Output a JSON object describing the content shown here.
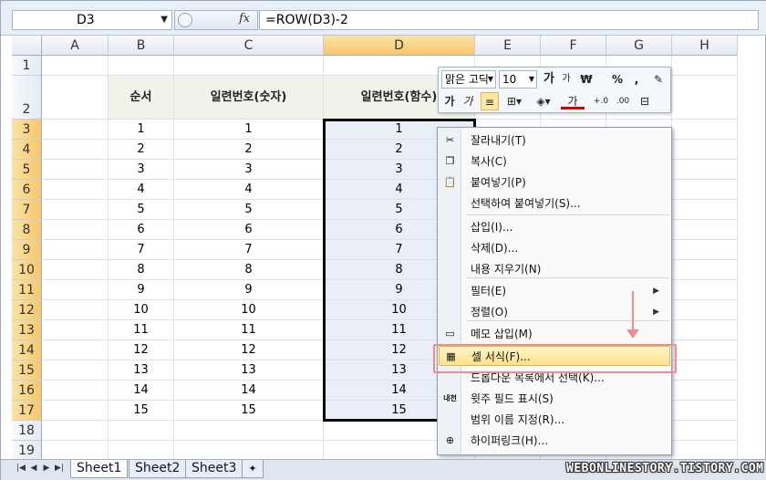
{
  "formula_bar": {
    "name_box": "D3",
    "fx_label": "fx",
    "formula": "=ROW(D3)-2"
  },
  "columns": [
    "A",
    "B",
    "C",
    "D",
    "E",
    "F",
    "G",
    "H"
  ],
  "rows": [
    "1",
    "2",
    "3",
    "4",
    "5",
    "6",
    "7",
    "8",
    "9",
    "10",
    "11",
    "12",
    "13",
    "14",
    "15",
    "16",
    "17",
    "18",
    "19"
  ],
  "table": {
    "headers": [
      "순서",
      "일련번호(숫자)",
      "일련번호(함수)"
    ],
    "order": [
      "1",
      "2",
      "3",
      "4",
      "5",
      "6",
      "7",
      "8",
      "9",
      "10",
      "11",
      "12",
      "13",
      "14",
      "15"
    ],
    "serial_number": [
      "1",
      "2",
      "3",
      "4",
      "5",
      "6",
      "7",
      "8",
      "9",
      "10",
      "11",
      "12",
      "13",
      "14",
      "15"
    ],
    "serial_function": [
      "1",
      "2",
      "3",
      "4",
      "5",
      "6",
      "7",
      "8",
      "9",
      "10",
      "11",
      "12",
      "13",
      "14",
      "15"
    ]
  },
  "mini_toolbar": {
    "font_name": "맑은 고딕",
    "font_size": "10",
    "grow_font": "가",
    "shrink_font": "가",
    "currency": "₩",
    "percent": "%",
    "comma": ",",
    "bold": "가",
    "italic": "가",
    "font_color": "가"
  },
  "context_menu": {
    "items": [
      {
        "label": "잘라내기(T)",
        "icon": "scissors-icon"
      },
      {
        "label": "복사(C)",
        "icon": "copy-icon"
      },
      {
        "label": "붙여넣기(P)",
        "icon": "paste-icon"
      },
      {
        "label": "선택하여 붙여넣기(S)..."
      },
      {
        "label": "삽입(I)..."
      },
      {
        "label": "삭제(D)..."
      },
      {
        "label": "내용 지우기(N)"
      },
      {
        "label": "필터(E)"
      },
      {
        "label": "정렬(O)"
      },
      {
        "label": "메모 삽입(M)",
        "icon": "comment-icon"
      },
      {
        "label": "셀 서식(F)...",
        "icon": "format-cells-icon"
      },
      {
        "label": "드롭다운 목록에서 선택(K)..."
      },
      {
        "label": "윗주 필드 표시(S)",
        "icon": "phonetic-icon"
      },
      {
        "label": "범위 이름 지정(R)..."
      },
      {
        "label": "하이퍼링크(H)...",
        "icon": "hyperlink-icon"
      }
    ],
    "phonetic_icon_text": "내천"
  },
  "sheet_tabs": [
    "Sheet1",
    "Sheet2",
    "Sheet3"
  ],
  "active_sheet": "Sheet1",
  "watermark": "WEBONLINESTORY.TISTORY.COM",
  "colors": {
    "selection_header": "#f6c86a",
    "menu_highlight": "#ffe08a",
    "annotation_red": "#f08c8c"
  }
}
